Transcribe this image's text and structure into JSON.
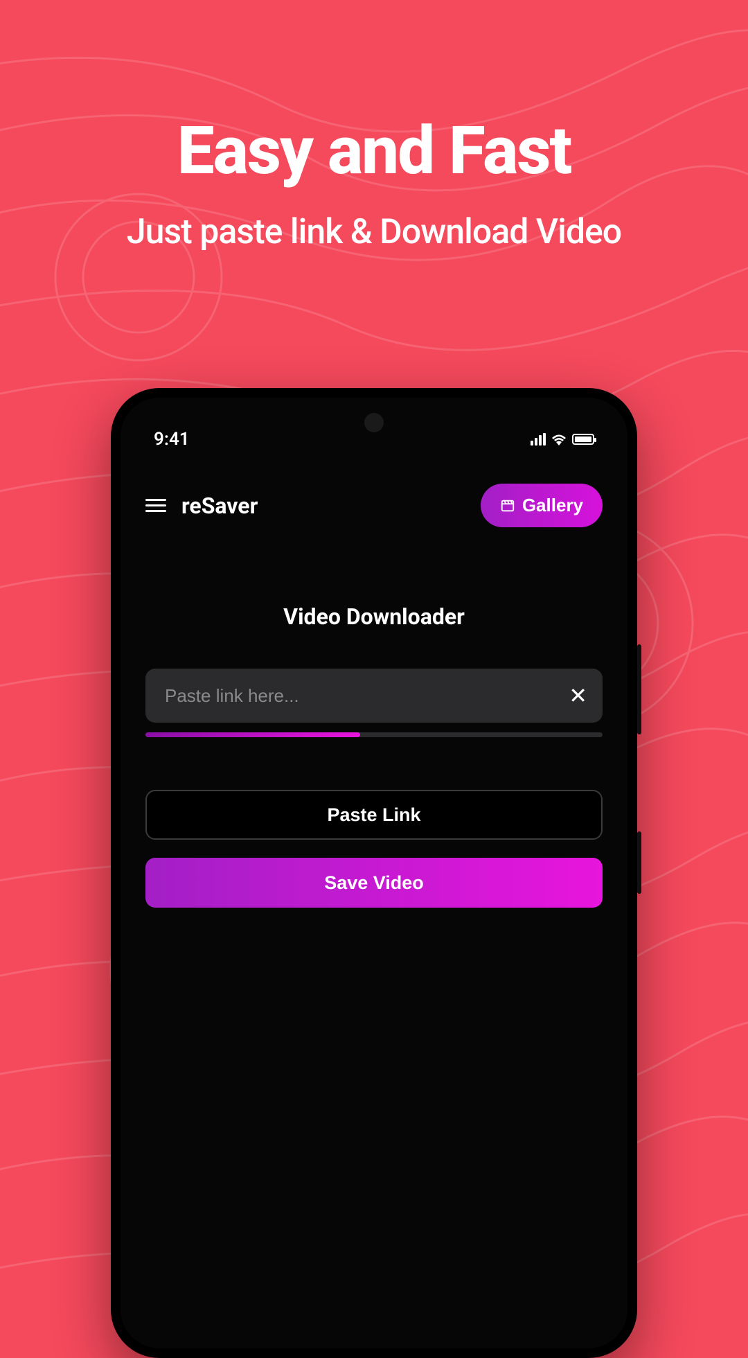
{
  "hero": {
    "title": "Easy and Fast",
    "subtitle": "Just paste link & Download Video"
  },
  "status": {
    "time": "9:41"
  },
  "appbar": {
    "app_name": "reSaver",
    "gallery_label": "Gallery"
  },
  "main": {
    "section_title": "Video Downloader",
    "input_placeholder": "Paste link here...",
    "progress_percent": 47,
    "paste_label": "Paste Link",
    "save_label": "Save Video"
  }
}
